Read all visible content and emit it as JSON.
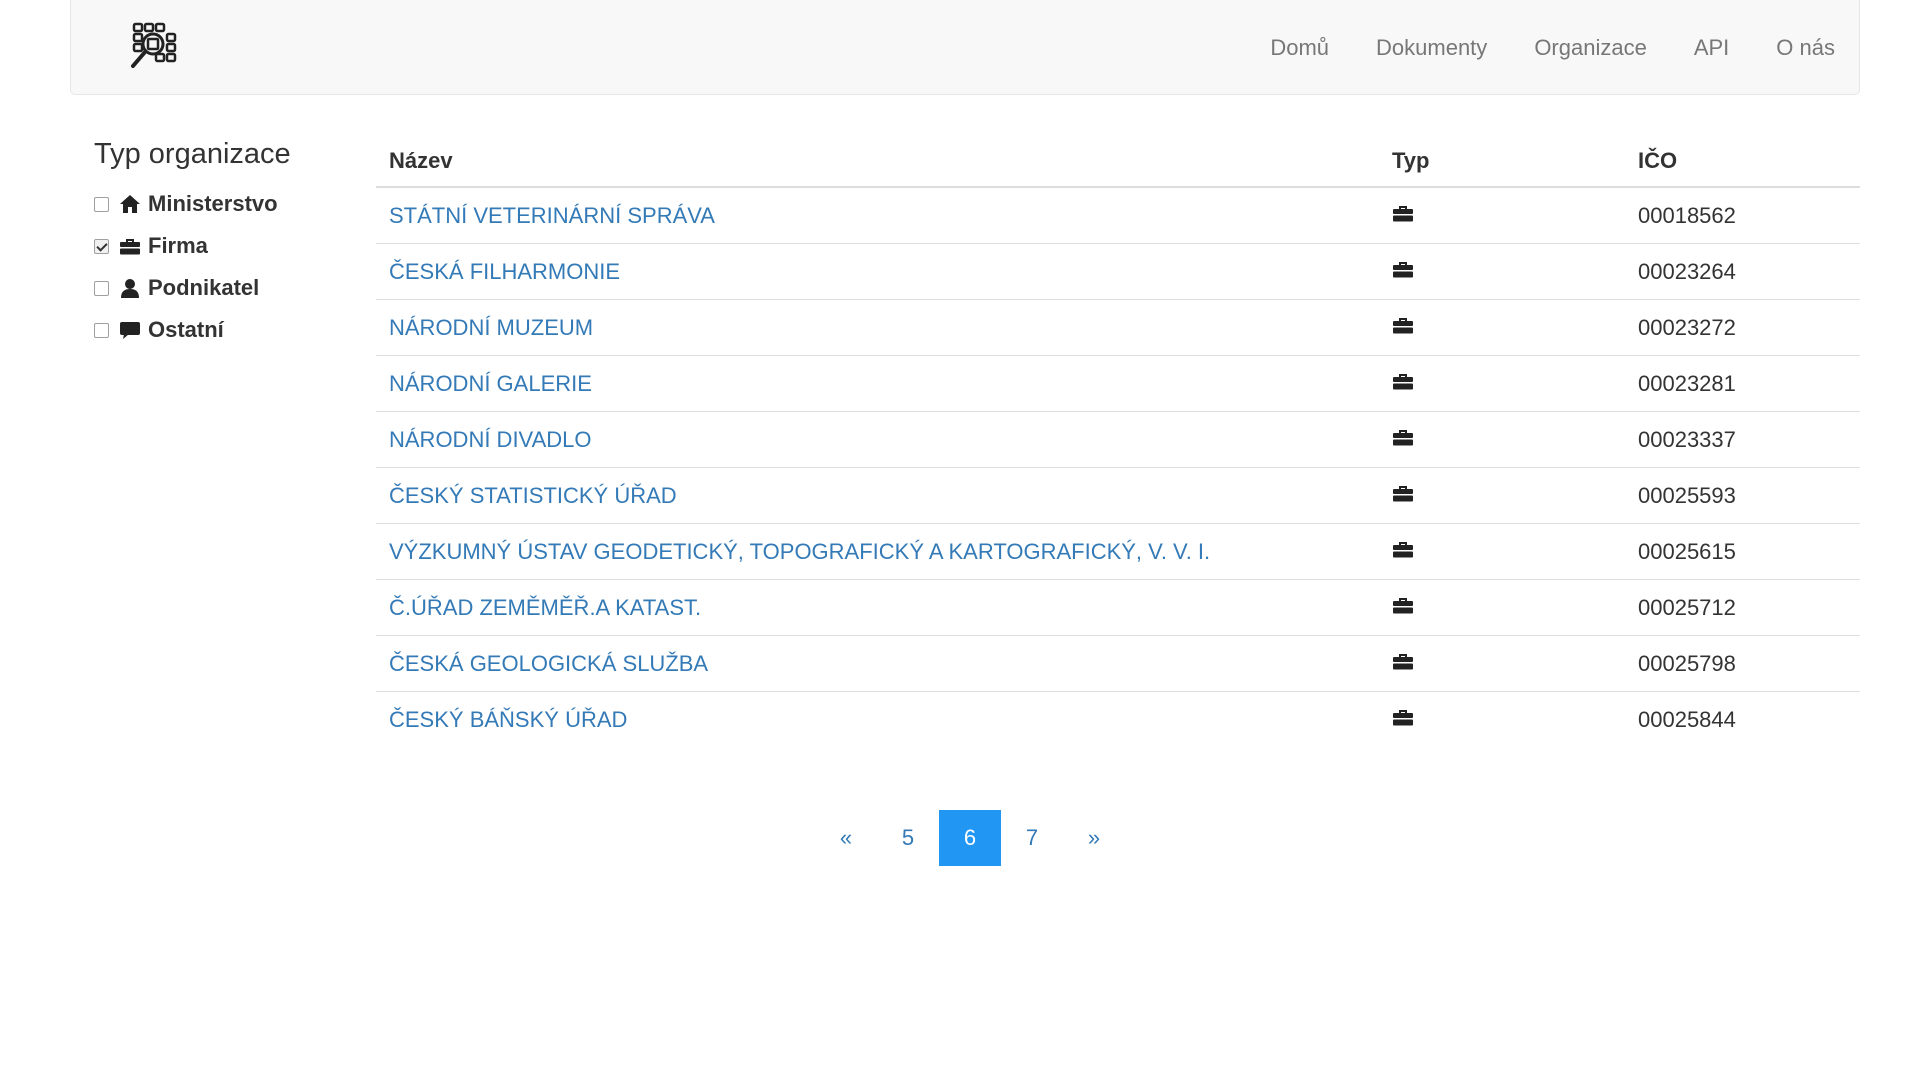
{
  "navbar": {
    "brand_icon": "search-grid-logo-icon",
    "links": [
      "Domů",
      "Dokumenty",
      "Organizace",
      "API",
      "O nás"
    ]
  },
  "sidebar": {
    "title": "Typ organizace",
    "filters": [
      {
        "label": "Ministerstvo",
        "icon": "home-icon",
        "checked": false
      },
      {
        "label": "Firma",
        "icon": "briefcase-icon",
        "checked": true
      },
      {
        "label": "Podnikatel",
        "icon": "user-icon",
        "checked": false
      },
      {
        "label": "Ostatní",
        "icon": "comment-icon",
        "checked": false
      }
    ]
  },
  "table": {
    "headers": [
      "Název",
      "Typ",
      "IČO"
    ],
    "type_icon": "briefcase-icon",
    "rows": [
      {
        "name": "STÁTNÍ VETERINÁRNÍ SPRÁVA",
        "ico": "00018562"
      },
      {
        "name": "ČESKÁ FILHARMONIE",
        "ico": "00023264"
      },
      {
        "name": "NÁRODNÍ MUZEUM",
        "ico": "00023272"
      },
      {
        "name": "NÁRODNÍ GALERIE",
        "ico": "00023281"
      },
      {
        "name": "NÁRODNÍ DIVADLO",
        "ico": "00023337"
      },
      {
        "name": "ČESKÝ STATISTICKÝ ÚŘAD",
        "ico": "00025593"
      },
      {
        "name": "VÝZKUMNÝ ÚSTAV GEODETICKÝ, TOPOGRAFICKÝ A KARTOGRAFICKÝ, V. V. I.",
        "ico": "00025615"
      },
      {
        "name": "Č.ÚŘAD ZEMĚMĚŘ.A KATAST.",
        "ico": "00025712"
      },
      {
        "name": "ČESKÁ GEOLOGICKÁ SLUŽBA",
        "ico": "00025798"
      },
      {
        "name": "ČESKÝ BÁŇSKÝ ÚŘAD",
        "ico": "00025844"
      }
    ]
  },
  "pagination": {
    "prev": "«",
    "pages": [
      "5",
      "6",
      "7"
    ],
    "current": "6",
    "next": "»"
  },
  "colors": {
    "link": "#337ab7",
    "active_page": "#2196f3",
    "navbar_bg": "#f8f8f8"
  }
}
